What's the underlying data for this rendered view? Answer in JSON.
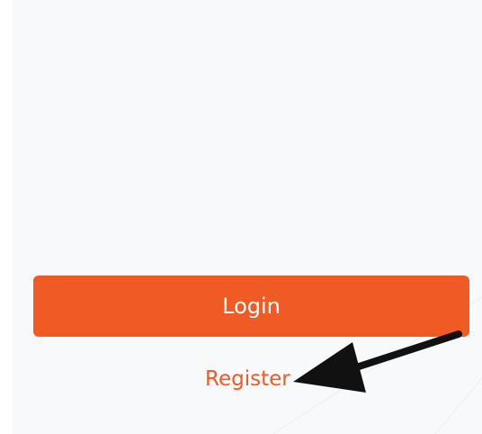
{
  "login_button": {
    "label": "Login"
  },
  "register_link": {
    "label": "Register"
  },
  "colors": {
    "accent": "#f05a24",
    "background": "#f8f9fa",
    "button_text": "#ffffff",
    "annotation_arrow": "#111111"
  },
  "icons": {
    "annotation": "arrow-pointer-icon"
  }
}
